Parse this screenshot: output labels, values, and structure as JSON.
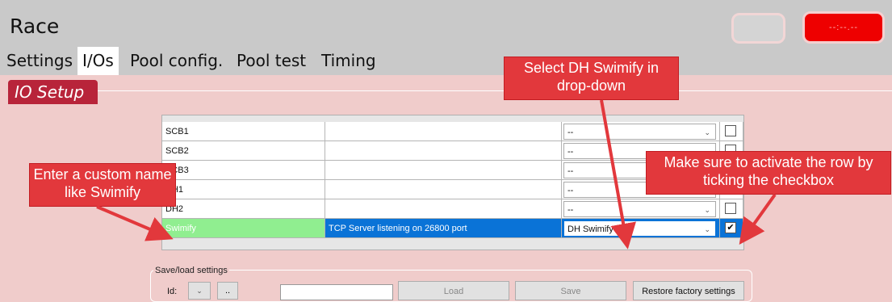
{
  "app": {
    "title": "Race",
    "clock_text": "--:--.--"
  },
  "tabs": [
    "Settings",
    "I/Os",
    "Pool config.",
    "Pool test",
    "Timing"
  ],
  "io_setup": {
    "legend": "IO Setup"
  },
  "grid": {
    "rows": [
      {
        "name": "SCB1",
        "description": "",
        "type": "--",
        "checked": false
      },
      {
        "name": "SCB2",
        "description": "",
        "type": "--",
        "checked": false
      },
      {
        "name": "SCB3",
        "description": "",
        "type": "--",
        "checked": false
      },
      {
        "name": "DH1",
        "description": "",
        "type": "--",
        "checked": false
      },
      {
        "name": "DH2",
        "description": "",
        "type": "--",
        "checked": false
      },
      {
        "name": "Swimify",
        "description": "TCP Server listening on 26800 port",
        "type": "DH Swimify",
        "checked": true
      }
    ],
    "check_mark": "✔"
  },
  "save_load": {
    "title": "Save/load settings",
    "id_label": "Id:",
    "dots_label": "..",
    "load_label": "Load",
    "save_label": "Save",
    "restore_label": "Restore factory settings"
  },
  "callouts": {
    "dropdown": "Select DH Swimify in drop-down",
    "name": "Enter a custom name like Swimify",
    "checkbox": "Make sure to activate the row by ticking the checkbox"
  },
  "colors": {
    "accent_red": "#e2383c",
    "legend_red": "#b8243a",
    "selection_blue": "#0a73d7",
    "name_green": "#90ee90"
  }
}
